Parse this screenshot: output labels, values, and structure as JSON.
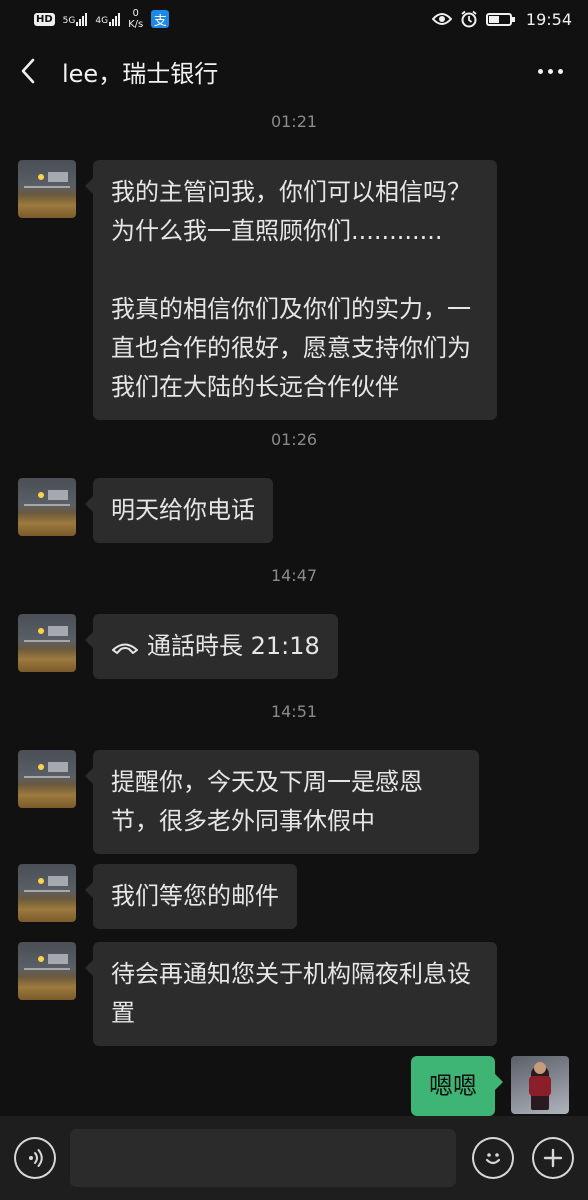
{
  "status_bar": {
    "hd": "HD",
    "sim1": "5G",
    "sim2": "4G",
    "speed_value": "0",
    "speed_unit": "K/s",
    "app_glyph": "支",
    "time": "19:54"
  },
  "header": {
    "title": "lee，瑞士银行"
  },
  "messages": [
    {
      "type": "time",
      "text": "01:21"
    },
    {
      "type": "in",
      "paragraphs": [
        "我的主管问我，你们可以相信吗？为什么我一直照顾你们............",
        "我真的相信你们及你们的实力，一直也合作的很好，愿意支持你们为我们在大陆的长远合作伙伴"
      ]
    },
    {
      "type": "time",
      "text": "01:26"
    },
    {
      "type": "in",
      "text": "明天给你电话"
    },
    {
      "type": "time",
      "text": "14:47"
    },
    {
      "type": "call",
      "text": "通話時長 21:18",
      "icon": "phone-hangup-icon"
    },
    {
      "type": "time",
      "text": "14:51"
    },
    {
      "type": "in",
      "text": "提醒你，今天及下周一是感恩节，很多老外同事休假中"
    },
    {
      "type": "in",
      "text": "我们等您的邮件"
    },
    {
      "type": "in",
      "text": "待会再通知您关于机构隔夜利息设置"
    },
    {
      "type": "out",
      "text": "嗯嗯"
    }
  ],
  "input_bar": {
    "placeholder": "",
    "icons": [
      "voice-icon",
      "emoji-icon",
      "plus-icon"
    ]
  },
  "colors": {
    "background": "#111111",
    "bubble_in": "#2c2c2c",
    "bubble_out": "#3eb575",
    "timestamp": "#8a8a8a"
  }
}
